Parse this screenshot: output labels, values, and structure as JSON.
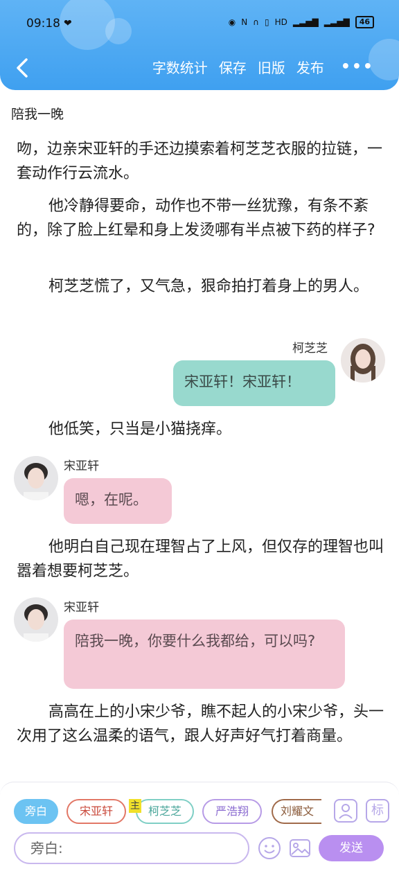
{
  "status_bar": {
    "time": "09:18",
    "battery": "46"
  },
  "toolbar": {
    "word_count_label": "字数统计",
    "save_label": "保存",
    "old_version_label": "旧版",
    "publish_label": "发布",
    "more_label": "•••"
  },
  "document": {
    "title": "陪我一晚",
    "paragraph_1": "吻，边亲宋亚轩的手还边摸索着柯芝芝衣服的拉链，一套动作行云流水。",
    "paragraph_2": "他冷静得要命，动作也不带一丝犹豫，有条不紊的，除了脸上红晕和身上发烫哪有半点被下药的样子?",
    "paragraph_3": "柯芝芝慌了，又气急，狠命拍打着身上的男人。",
    "dialog_1": {
      "speaker": "柯芝芝",
      "text": "宋亚轩！宋亚轩！"
    },
    "paragraph_4": "他低笑，只当是小猫挠痒。",
    "dialog_2": {
      "speaker": "宋亚轩",
      "text": "嗯，在呢。"
    },
    "paragraph_5": "他明白自己现在理智占了上风，但仅存的理智也叫嚣着想要柯芝芝。",
    "dialog_3": {
      "speaker": "宋亚轩",
      "text": "陪我一晚，你要什么我都给，可以吗?"
    },
    "paragraph_6": "高高在上的小宋少爷，瞧不起人的小宋少爷，头一次用了这么温柔的语气，跟人好声好气打着商量。"
  },
  "composer": {
    "chips": [
      "旁白",
      "宋亚轩",
      "柯芝芝",
      "严浩翔",
      "刘耀文"
    ],
    "main_badge": "主",
    "mark_label": "标",
    "input_value": "旁白:",
    "send_label": "发送"
  },
  "colors": {
    "header": "#4aa8f2",
    "teal_bubble": "#98d9ce",
    "pink_bubble": "#f4c9d6",
    "send_button": "#b98ff0"
  }
}
